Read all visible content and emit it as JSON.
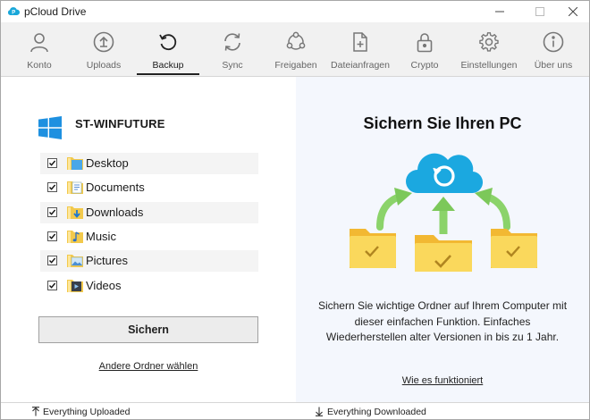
{
  "window": {
    "title": "pCloud Drive",
    "accent": "#19a7d9"
  },
  "toolbar": {
    "items": [
      {
        "label": "Konto",
        "icon": "person-icon"
      },
      {
        "label": "Uploads",
        "icon": "upload-icon"
      },
      {
        "label": "Backup",
        "icon": "backup-icon"
      },
      {
        "label": "Sync",
        "icon": "sync-icon"
      },
      {
        "label": "Freigaben",
        "icon": "share-icon"
      },
      {
        "label": "Dateianfragen",
        "icon": "file-request-icon"
      },
      {
        "label": "Crypto",
        "icon": "lock-icon"
      },
      {
        "label": "Einstellungen",
        "icon": "gear-icon"
      },
      {
        "label": "Über uns",
        "icon": "info-icon"
      }
    ],
    "active": "Backup"
  },
  "left": {
    "computer_name": "ST-WINFUTURE",
    "folders": [
      {
        "label": "Desktop",
        "checked": true,
        "icon": "desktop-folder-icon"
      },
      {
        "label": "Documents",
        "checked": true,
        "icon": "documents-folder-icon"
      },
      {
        "label": "Downloads",
        "checked": true,
        "icon": "downloads-folder-icon"
      },
      {
        "label": "Music",
        "checked": true,
        "icon": "music-folder-icon"
      },
      {
        "label": "Pictures",
        "checked": true,
        "icon": "pictures-folder-icon"
      },
      {
        "label": "Videos",
        "checked": true,
        "icon": "videos-folder-icon"
      }
    ],
    "backup_button": "Sichern",
    "other_folder_link": "Andere Ordner wählen"
  },
  "right": {
    "heading": "Sichern Sie Ihren PC",
    "description": "Sichern Sie wichtige Ordner auf Ihrem Computer mit dieser einfachen Funktion. Einfaches Wiederherstellen alter Versionen in bis zu 1 Jahr.",
    "how_link": "Wie es funktioniert"
  },
  "status": {
    "upload": "Everything Uploaded",
    "download": "Everything Downloaded"
  }
}
